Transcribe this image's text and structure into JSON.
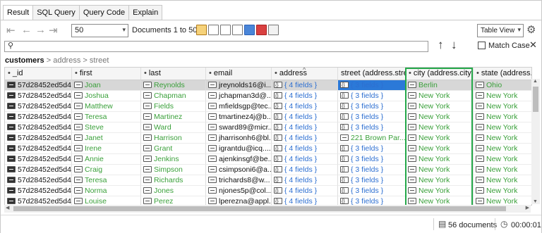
{
  "tabs": [
    "Result",
    "SQL Query",
    "Query Code",
    "Explain"
  ],
  "toolbar": {
    "page_size": "50",
    "doc_range": "Documents 1 to 50",
    "view": "Table View"
  },
  "search": {
    "placeholder": "",
    "match_case": "Match Case"
  },
  "breadcrumb": {
    "root": "customers",
    "sep": ">",
    "parts": [
      "address",
      "street"
    ]
  },
  "columns": [
    "_id",
    "first",
    "last",
    "email",
    "address",
    "street (address.street)",
    "city (address.city)",
    "state (address.state"
  ],
  "rows": [
    {
      "id": "57d28452ed5d4...",
      "first": "Joan",
      "last": "Reynolds",
      "email": "jreynolds16@i...",
      "address": "{ 4 fields }",
      "street": "{ 3 fields }",
      "city": "Berlin",
      "state": "Ohio"
    },
    {
      "id": "57d28452ed5d4...",
      "first": "Joshua",
      "last": "Chapman",
      "email": "jchapman3d@...",
      "address": "{ 4 fields }",
      "street": "{ 3 fields }",
      "city": "New York",
      "state": "New York"
    },
    {
      "id": "57d28452ed5d4...",
      "first": "Matthew",
      "last": "Fields",
      "email": "mfieldsgp@tec...",
      "address": "{ 4 fields }",
      "street": "{ 3 fields }",
      "city": "New York",
      "state": "New York"
    },
    {
      "id": "57d28452ed5d4...",
      "first": "Teresa",
      "last": "Martinez",
      "email": "tmartinez4j@b...",
      "address": "{ 4 fields }",
      "street": "{ 3 fields }",
      "city": "New York",
      "state": "New York"
    },
    {
      "id": "57d28452ed5d4...",
      "first": "Steve",
      "last": "Ward",
      "email": "sward89@micr...",
      "address": "{ 4 fields }",
      "street": "{ 3 fields }",
      "city": "New York",
      "state": "New York"
    },
    {
      "id": "57d28452ed5d4...",
      "first": "Janet",
      "last": "Harrison",
      "email": "jharrisonh6@bl...",
      "address": "{ 4 fields }",
      "street": "221 Brown Par...",
      "city": "New York",
      "state": "New York"
    },
    {
      "id": "57d28452ed5d4...",
      "first": "Irene",
      "last": "Grant",
      "email": "igrantdu@icq....",
      "address": "{ 4 fields }",
      "street": "{ 3 fields }",
      "city": "New York",
      "state": "New York"
    },
    {
      "id": "57d28452ed5d4...",
      "first": "Annie",
      "last": "Jenkins",
      "email": "ajenkinsgf@be...",
      "address": "{ 4 fields }",
      "street": "{ 3 fields }",
      "city": "New York",
      "state": "New York"
    },
    {
      "id": "57d28452ed5d4...",
      "first": "Craig",
      "last": "Simpson",
      "email": "csimpsoni6@a...",
      "address": "{ 4 fields }",
      "street": "{ 3 fields }",
      "city": "New York",
      "state": "New York"
    },
    {
      "id": "57d28452ed5d4...",
      "first": "Teresa",
      "last": "Richards",
      "email": "trichards8@w...",
      "address": "{ 4 fields }",
      "street": "{ 3 fields }",
      "city": "New York",
      "state": "New York"
    },
    {
      "id": "57d28452ed5d4...",
      "first": "Norma",
      "last": "Jones",
      "email": "njones5p@col...",
      "address": "{ 4 fields }",
      "street": "{ 3 fields }",
      "city": "New York",
      "state": "New York"
    },
    {
      "id": "57d28452ed5d4...",
      "first": "Louise",
      "last": "Perez",
      "email": "lperezna@appl...",
      "address": "{ 4 fields }",
      "street": "{ 3 fields }",
      "city": "New York",
      "state": "New York"
    }
  ],
  "status": {
    "documents": "56 documents",
    "time": "00:00:01"
  },
  "colors": {
    "green_text": "#3aa03a",
    "blue_text": "#2d6fd1",
    "highlight_border": "#25a84a",
    "selected_cell": "#2b79d8"
  }
}
